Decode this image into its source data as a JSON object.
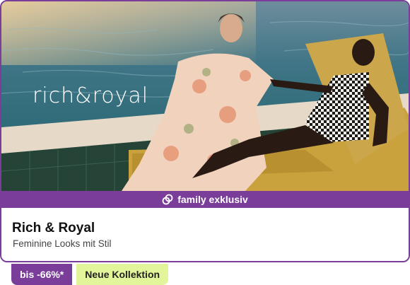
{
  "card": {
    "brand_logo_text": "rich&royal",
    "exclusive_label": "family exklusiv",
    "title": "Rich & Royal",
    "subtitle": "Feminine Looks mit Stil"
  },
  "badges": {
    "discount": "bis -66%*",
    "new": "Neue Kollektion"
  },
  "colors": {
    "accent": "#7a3d9a",
    "new_badge": "#e3f59a"
  },
  "icons": {
    "exclusive": "family-rings-icon"
  }
}
